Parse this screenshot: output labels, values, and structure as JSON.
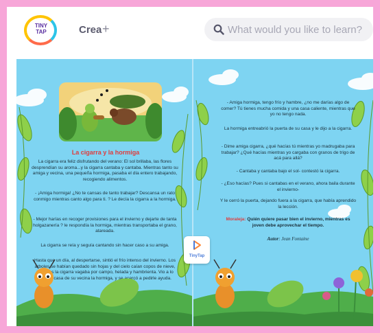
{
  "header": {
    "logo_text": "TINY TAP",
    "crea_label": "Crea",
    "plus_label": "+",
    "search_placeholder": "What would you like to learn?"
  },
  "story": {
    "title": "La cigarra y la hormiga",
    "left_paragraphs": [
      "La cigarra era feliz disfrutando del verano: El sol brillaba, las flores desprendían su aroma...y la cigarra cantaba y cantaba. Mientras tanto su amiga y vecina, una pequeña hormiga, pasaba el día entero trabajando, recogiendo alimentos.",
      "- ¡Amiga hormiga! ¿No te cansas de tanto trabajar? Descansa un rato conmigo mientras canto algo para ti. ? Le decía la cigarra a la hormiga.",
      "- Mejor harías en recoger provisiones para el invierno y dejarte de tanta holgazanería ? le respondía la hormiga, mientras transportaba el grano, atareada.",
      "La cigarra se reía y seguía cantando sin hacer caso a su amiga.",
      "Hasta que un día, al despertarse, sintió el frío intenso del invierno. Los árboles se habían quedado sin hojas y del cielo caían copos de nieve, mientras la cigarra vagaba por campo, helada y hambrienta. Vio a lo lejos la casa de su vecina la hormiga, y se acercó a pedirle ayuda."
    ],
    "right_paragraphs": [
      "- Amiga hormiga, tengo frío y hambre, ¿no me darías algo de comer? Tú tienes mucha comida y una casa caliente, mientras que yo no tengo nada.",
      "La hormiga entreabrió la puerta de su casa y le dijo a la cigarra.",
      "- Dime amiga cigarra, ¿qué hacías tú mientras yo madrugaba para trabajar? ¿Qué hacías mientras yo cargaba con granos de trigo de acá para allá?",
      "- Cantaba y cantaba bajo el sol- contestó la cigarra.",
      "- ¿Eso hacías? Pues si cantabas en el verano, ahora baila durante el invierno-",
      "Y le cerró la puerta, dejando fuera a la cigarra, que había aprendido la lección."
    ],
    "moral_label": "Moraleja:",
    "moral_text": "Quién quiere pasar bien el invierno, mientras es joven debe aprovechar el tiempo.",
    "author_label": "Autor",
    "author_name": ": Jean Fontaine"
  },
  "tinytap_badge": {
    "label": "TinyTap"
  },
  "colors": {
    "page_border": "#f7a6d8",
    "book_sky": "#7ed4f2",
    "title_red": "#e03c3c",
    "logo_purple": "#5a2fa0"
  }
}
